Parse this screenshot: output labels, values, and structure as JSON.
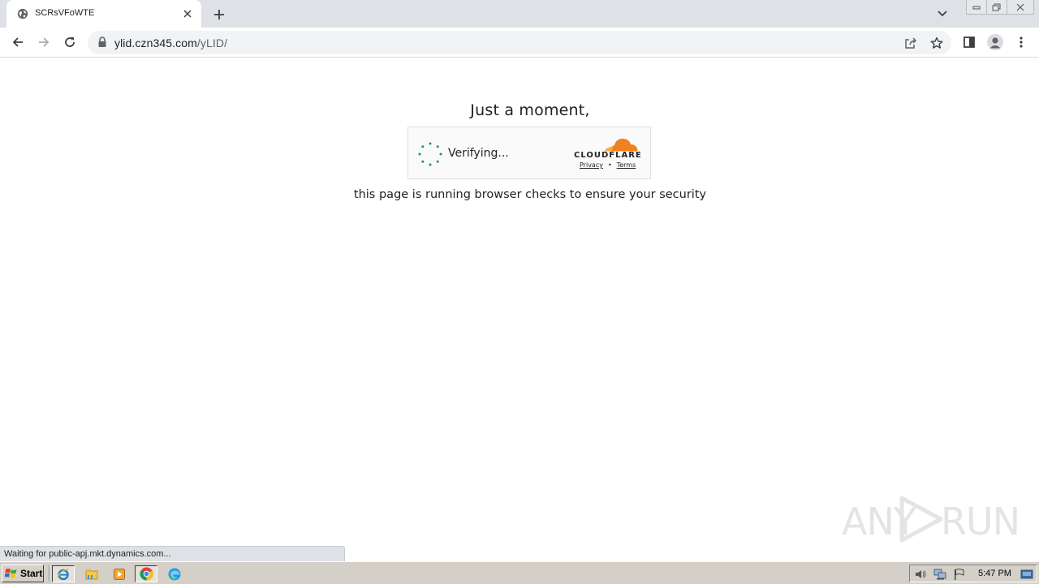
{
  "browser": {
    "tab_title": "SCRsVFoWTE",
    "url_host": "ylid.czn345.com",
    "url_path": "/yLID/",
    "status_text": "Waiting for public-apj.mkt.dynamics.com..."
  },
  "page": {
    "heading": "Just a moment,",
    "verifying_label": "Verifying...",
    "brand": "CLOUDFLARE",
    "privacy_link": "Privacy",
    "link_separator": "•",
    "terms_link": "Terms",
    "subtext": "this page is running browser checks to ensure your security"
  },
  "watermark": {
    "text_left": "ANY",
    "text_right": "RUN"
  },
  "taskbar": {
    "start_label": "Start",
    "clock": "5:47 PM"
  },
  "colors": {
    "cloudflare_orange": "#f38020",
    "spinner_green": "#199950",
    "chrome_bg": "#dee1e6"
  }
}
